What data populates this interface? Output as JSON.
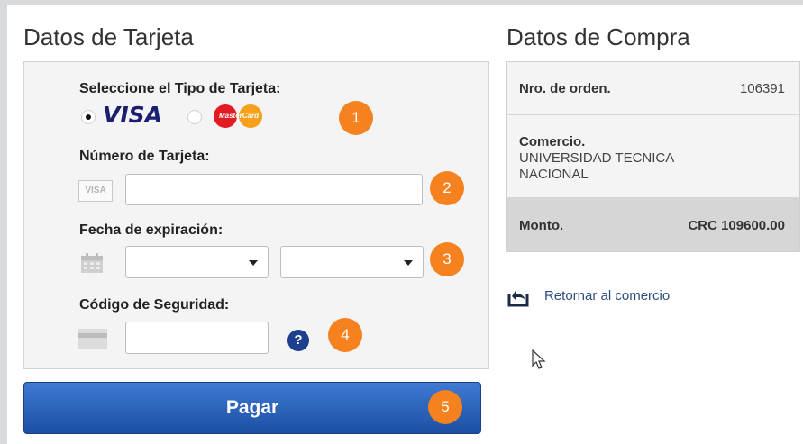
{
  "left": {
    "title": "Datos de Tarjeta",
    "card_type_label": "Seleccione el Tipo de Tarjeta:",
    "visa_label": "VISA",
    "mastercard_label": "MasterCard",
    "card_number_label": "Número de Tarjeta:",
    "card_icon_text": "VISA",
    "expiry_label": "Fecha de expiración:",
    "security_label": "Código de Seguridad:",
    "help_symbol": "?",
    "pay_label": "Pagar",
    "steps": [
      "1",
      "2",
      "3",
      "4",
      "5"
    ]
  },
  "right": {
    "title": "Datos de Compra",
    "order_label": "Nro. de orden.",
    "order_value": "106391",
    "merchant_label": "Comercio.",
    "merchant_line1": "UNIVERSIDAD TECNICA",
    "merchant_line2": "NACIONAL",
    "amount_label": "Monto.",
    "amount_value": "CRC 109600.00",
    "return_label": "Retornar al comercio"
  },
  "colors": {
    "badge": "#f5821f",
    "pay_button": "#2a62bb",
    "help": "#1d3f8f",
    "visa": "#1a1f71"
  },
  "icons": [
    "card-icon",
    "calendar-icon",
    "security-card-icon",
    "help-icon",
    "return-arrow-icon",
    "mouse-cursor-icon"
  ]
}
